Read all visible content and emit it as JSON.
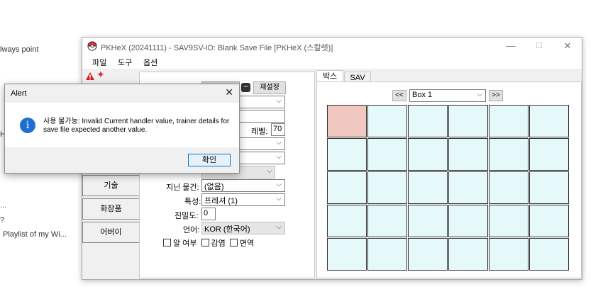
{
  "background": {
    "snippets": [
      "lways point",
      "H",
      "...",
      "?",
      "Playlist of my Wi..."
    ]
  },
  "window": {
    "title": "PKHeX (20241111) - SAV9SV-ID: Blank Save File [PKHeX (스칼렛)]",
    "minimize": "—",
    "maximize": "☐",
    "close": "✕",
    "menu": [
      "파일",
      "도구",
      "옵션"
    ]
  },
  "editor": {
    "reroll_button": "재설정",
    "level_label": "레벨:",
    "level_value": "70",
    "ball_value": "",
    "side_tabs": [
      "기술",
      "화장품",
      "어버이"
    ],
    "held_item_label": "지닌 물건:",
    "held_item_value": "(없음)",
    "ability_label": "특성:",
    "ability_value": "프레셔 (1)",
    "friendship_label": "친밀도:",
    "friendship_value": "0",
    "language_label": "언어:",
    "language_value": "KOR (한국어)",
    "checkboxes": [
      "알 여부",
      "감염",
      "면역"
    ]
  },
  "box_panel": {
    "tabs": [
      "박스",
      "SAV"
    ],
    "prev": "<<",
    "next": ">>",
    "box_name": "Box 1",
    "highlight_color": "#f0c8c0",
    "cell_color": "#e6f9fa"
  },
  "alert": {
    "title": "Alert",
    "close": "✕",
    "icon": "i",
    "message": "사용 불가능: Invalid Current handler value, trainer details for save file expected another value.",
    "ok": "확인"
  }
}
